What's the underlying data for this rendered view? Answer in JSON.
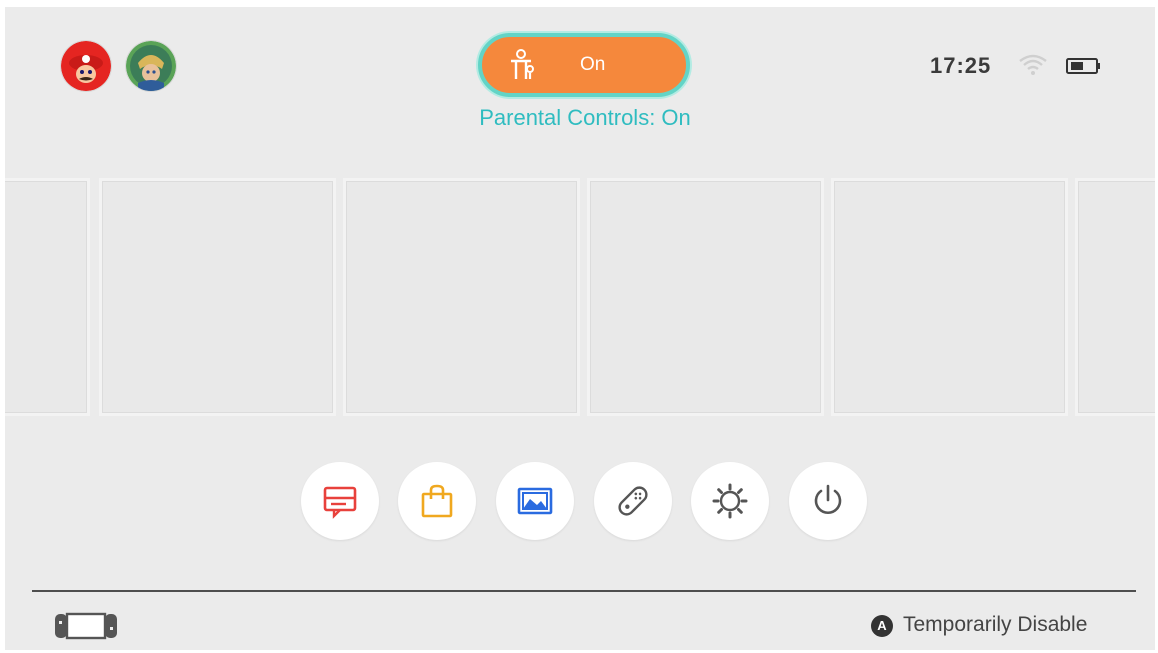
{
  "header": {
    "users": [
      {
        "icon": "mario-avatar-icon"
      },
      {
        "icon": "link-avatar-icon"
      }
    ],
    "parental_toggle": {
      "state": "On",
      "label": "Parental Controls: On",
      "icon": "parental-controls-icon",
      "colors": {
        "fill": "#f5883c",
        "ring": "#63d4c6",
        "label": "#2fbcc0"
      }
    },
    "status": {
      "time": "17:25",
      "wifi_icon": "wifi-icon",
      "battery_icon": "battery-icon"
    }
  },
  "games": {
    "tiles": 6
  },
  "bottom_menu": [
    {
      "name": "news",
      "icon": "news-icon",
      "color": "#e8413c"
    },
    {
      "name": "eshop",
      "icon": "shopping-bag-icon",
      "color": "#f0a81f"
    },
    {
      "name": "album",
      "icon": "album-icon",
      "color": "#2a6be0"
    },
    {
      "name": "controllers",
      "icon": "joycon-icon",
      "color": "#555555"
    },
    {
      "name": "settings",
      "icon": "gear-icon",
      "color": "#555555"
    },
    {
      "name": "power",
      "icon": "power-icon",
      "color": "#555555"
    }
  ],
  "footer": {
    "console_icon": "switch-console-icon",
    "action_button": "A",
    "action_label": "Temporarily Disable"
  }
}
